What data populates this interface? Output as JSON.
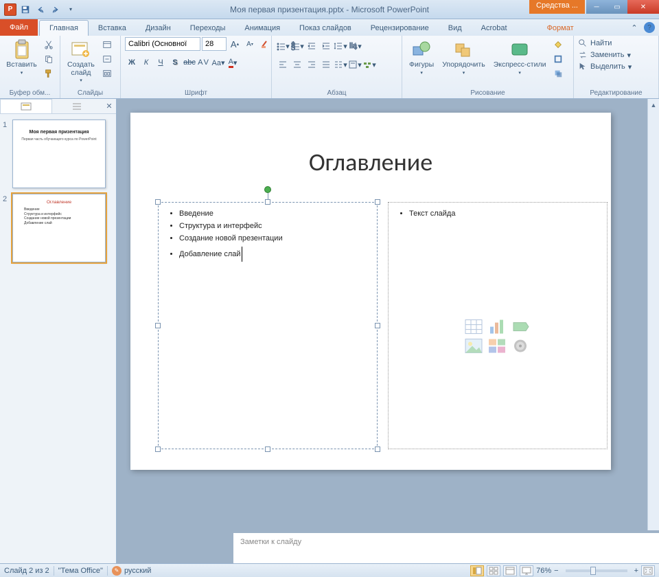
{
  "window": {
    "title": "Моя первая призентация.pptx - Microsoft PowerPoint",
    "context_tab": "Средства ..."
  },
  "tabs": {
    "file": "Файл",
    "list": [
      "Главная",
      "Вставка",
      "Дизайн",
      "Переходы",
      "Анимация",
      "Показ слайдов",
      "Рецензирование",
      "Вид",
      "Acrobat"
    ],
    "context": "Формат",
    "active": "Главная"
  },
  "ribbon": {
    "clipboard": {
      "label": "Буфер обм...",
      "paste": "Вставить"
    },
    "slides": {
      "label": "Слайды",
      "new": "Создать\nслайд"
    },
    "font": {
      "label": "Шрифт",
      "name": "Calibri (Основної",
      "size": "28"
    },
    "paragraph": {
      "label": "Абзац"
    },
    "drawing": {
      "label": "Рисование",
      "shapes": "Фигуры",
      "arrange": "Упорядочить",
      "styles": "Экспресс-стили"
    },
    "editing": {
      "label": "Редактирование",
      "find": "Найти",
      "replace": "Заменить",
      "select": "Выделить"
    }
  },
  "thumbs": {
    "slide1": {
      "title": "Моя первая призентация",
      "sub": "Первая часть обучающего курса по PowerPoint"
    },
    "slide2": {
      "title": "Оглавление",
      "items": [
        "Введение",
        "Структура и интерфейс",
        "Создание новой презентации",
        "Добавление слай"
      ]
    }
  },
  "slide": {
    "title": "Оглавление",
    "bullets": [
      "Введение",
      "Структура и интерфейс",
      "Создание новой презентации",
      "Добавление слай"
    ],
    "placeholder_text": "Текст слайда"
  },
  "notes": {
    "placeholder": "Заметки к слайду"
  },
  "status": {
    "slide_counter": "Слайд 2 из 2",
    "theme": "\"Тема Office\"",
    "language": "русский",
    "zoom": "76%"
  }
}
